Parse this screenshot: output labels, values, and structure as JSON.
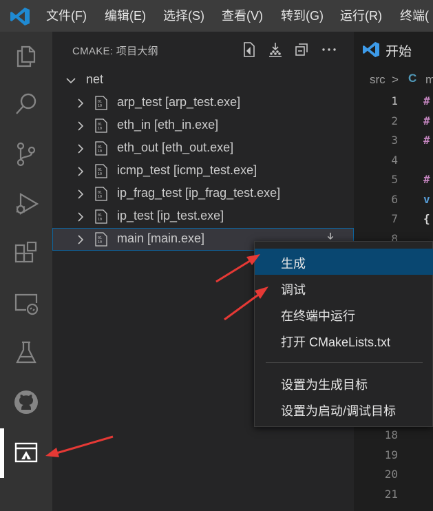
{
  "menubar": {
    "items": [
      "文件(F)",
      "编辑(E)",
      "选择(S)",
      "查看(V)",
      "转到(G)",
      "运行(R)",
      "终端("
    ]
  },
  "activity_bar": {
    "icons": [
      "explorer-icon",
      "search-icon",
      "source-control-icon",
      "run-debug-icon",
      "extensions-icon",
      "remote-explorer-icon",
      "testing-icon",
      "github-icon",
      "cmake-icon"
    ]
  },
  "sidebar": {
    "title": "CMAKE: 项目大纲",
    "root": "net",
    "targets": [
      "arp_test [arp_test.exe]",
      "eth_in [eth_in.exe]",
      "eth_out [eth_out.exe]",
      "icmp_test [icmp_test.exe]",
      "ip_frag_test [ip_frag_test.exe]",
      "ip_test [ip_test.exe]",
      "main [main.exe]"
    ]
  },
  "editor": {
    "tab_label": "开始",
    "breadcrumb_folder": "src",
    "breadcrumb_sep": ">",
    "breadcrumb_lang": "C",
    "breadcrumb_file": "m",
    "line_numbers": [
      "1",
      "2",
      "3",
      "4",
      "5",
      "6",
      "7",
      "8",
      "18",
      "19",
      "20",
      "21"
    ],
    "code_fragments": [
      "#",
      "#",
      "#",
      "#",
      "v",
      "{"
    ]
  },
  "context_menu": {
    "items": [
      "生成",
      "调试",
      "在终端中运行",
      "打开 CMakeLists.txt",
      "设置为生成目标",
      "设置为启动/调试目标"
    ]
  },
  "colors": {
    "accent": "#0e639c",
    "highlight": "#094771",
    "arrow": "#e53935",
    "vscode_blue": "#3d9be9"
  }
}
